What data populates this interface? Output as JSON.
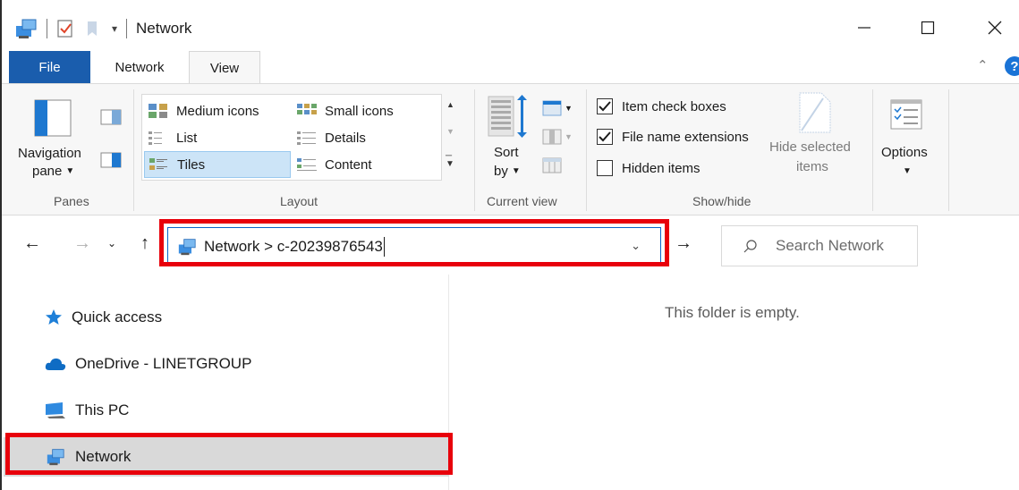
{
  "window": {
    "title": "Network",
    "controls": [
      "minimize",
      "maximize",
      "close"
    ]
  },
  "ribbon": {
    "tabs": {
      "file": "File",
      "network": "Network",
      "view": "View"
    },
    "panes": {
      "navigation_pane_line1": "Navigation",
      "navigation_pane_line2": "pane",
      "group_label": "Panes"
    },
    "layout": {
      "items": [
        "Medium icons",
        "Small icons",
        "List",
        "Details",
        "Tiles",
        "Content"
      ],
      "selected": "Tiles",
      "group_label": "Layout"
    },
    "current_view": {
      "sort_line1": "Sort",
      "sort_line2": "by",
      "group_label": "Current view"
    },
    "show_hide": {
      "item_check_boxes": "Item check boxes",
      "item_check_boxes_checked": true,
      "file_name_extensions": "File name extensions",
      "file_name_extensions_checked": true,
      "hidden_items": "Hidden items",
      "hidden_items_checked": false,
      "hide_selected_line1": "Hide selected",
      "hide_selected_line2": "items",
      "group_label": "Show/hide"
    },
    "options": {
      "label": "Options"
    }
  },
  "address": {
    "path": "Network > c-20239876543"
  },
  "search": {
    "placeholder": "Search Network"
  },
  "nav_pane": {
    "items": [
      {
        "label": "Quick access",
        "icon": "star-icon"
      },
      {
        "label": "OneDrive - LINETGROUP",
        "icon": "cloud-icon"
      },
      {
        "label": "This PC",
        "icon": "computer-icon"
      },
      {
        "label": "Network",
        "icon": "network-icon",
        "selected": true
      }
    ]
  },
  "content": {
    "empty_message": "This folder is empty."
  },
  "colors": {
    "accent": "#1a5dad",
    "highlight": "#e8000b",
    "selected_bg": "#d9d9d9"
  }
}
